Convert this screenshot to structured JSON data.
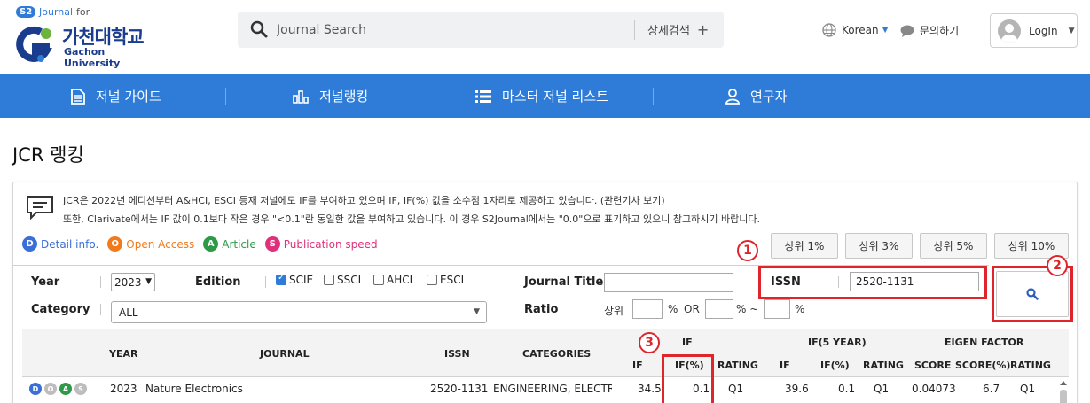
{
  "header": {
    "logo_badge": "S2",
    "logo_journal": "Journal",
    "logo_for": "for",
    "logo_korean": "가천대학교",
    "logo_english": "Gachon University",
    "search_placeholder": "Journal Search",
    "advanced_search": "상세검색",
    "language": "Korean",
    "inquiry": "문의하기",
    "login": "LogIn"
  },
  "nav": {
    "items": [
      {
        "label": "저널 가이드",
        "icon": "document-icon"
      },
      {
        "label": "저널랭킹",
        "icon": "bar-chart-icon"
      },
      {
        "label": "마스터 저널 리스트",
        "icon": "list-icon"
      },
      {
        "label": "연구자",
        "icon": "user-icon"
      }
    ]
  },
  "page_title": "JCR 랭킹",
  "notice": {
    "line1": "JCR은 2022년 에디션부터 A&HCI, ESCI 등재 저널에도 IF를 부여하고 있으며 IF, IF(%) 값을 소수점 1자리로 제공하고 있습니다. (관련기사 보기)",
    "line2": "또한, Clarivate에서는 IF 값이 0.1보다 작은 경우 \"<0.1\"란 동일한 값을 부여하고 있습니다. 이 경우 S2Journal에서는 \"0.0\"으로 표기하고 있으니 참고하시기 바랍니다."
  },
  "legend": [
    {
      "letter": "D",
      "label": "Detail info.",
      "color": "#3a6fd8"
    },
    {
      "letter": "O",
      "label": "Open Access",
      "color": "#f07a1c"
    },
    {
      "letter": "A",
      "label": "Article",
      "color": "#2e9a48"
    },
    {
      "letter": "S",
      "label": "Publication speed",
      "color": "#e0307a"
    }
  ],
  "percent_buttons": [
    "상위 1%",
    "상위 3%",
    "상위 5%",
    "상위 10%"
  ],
  "filters": {
    "year_label": "Year",
    "year_value": "2023",
    "edition_label": "Edition",
    "editions": [
      {
        "label": "SCIE",
        "checked": true
      },
      {
        "label": "SSCI",
        "checked": false
      },
      {
        "label": "AHCI",
        "checked": false
      },
      {
        "label": "ESCI",
        "checked": false
      }
    ],
    "journal_title_label": "Journal Title",
    "journal_title_value": "",
    "issn_label": "ISSN",
    "issn_value": "2520-1131",
    "category_label": "Category",
    "category_value": "ALL",
    "ratio_label": "Ratio",
    "ratio_upper": "상위",
    "ratio_pct": "%",
    "ratio_or": "OR",
    "ratio_pct_tilde": "% ~",
    "ratio_pct_end": "%"
  },
  "annotations": [
    "1",
    "2",
    "3"
  ],
  "table": {
    "headers": {
      "year": "YEAR",
      "journal": "JOURNAL",
      "issn": "ISSN",
      "categories": "CATEGORIES",
      "if_group": "IF",
      "if": "IF",
      "if_pct": "IF(%)",
      "rating": "RATING",
      "if5_group": "IF(5 YEAR)",
      "if5": "IF",
      "if5_pct": "IF(%)",
      "rating5": "RATING",
      "eigen_group": "EIGEN FACTOR",
      "score": "SCORE",
      "score_pct": "SCORE(%)",
      "rating_e": "RATING"
    },
    "rows": [
      {
        "badges": [
          "D",
          "O",
          "A",
          "S"
        ],
        "year": "2023",
        "journal": "Nature Electronics",
        "issn": "2520-1131",
        "categories": "ENGINEERING, ELECTRIC...",
        "if": "34.5",
        "if_pct": "0.1",
        "rating": "Q1",
        "if5": "39.6",
        "if5_pct": "0.1",
        "rating5": "Q1",
        "score": "0.04073",
        "score_pct": "6.7",
        "rating_e": "Q1"
      }
    ]
  }
}
